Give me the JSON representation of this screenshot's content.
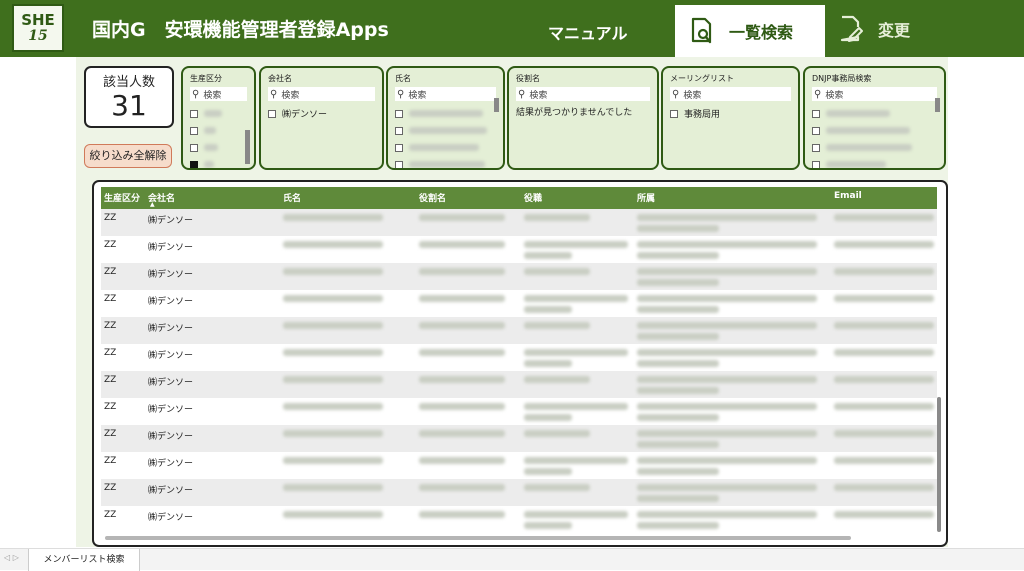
{
  "header": {
    "logo_line1": "SHE",
    "logo_line2": "15",
    "title": "国内G　安環機能管理者登録Apps",
    "nav": {
      "manual": "マニュアル",
      "search": "一覧検索",
      "change": "変更"
    }
  },
  "count": {
    "label": "該当人数",
    "value": "31"
  },
  "clear_filters": "絞り込み全解除",
  "search_placeholder": "検索",
  "slicers": {
    "production": {
      "title": "生産区分"
    },
    "company": {
      "title": "会社名",
      "item": "㈱デンソー"
    },
    "name": {
      "title": "氏名"
    },
    "role": {
      "title": "役割名",
      "no_result": "結果が見つかりませんでした"
    },
    "mailing": {
      "title": "メーリングリスト",
      "item": "事務局用"
    },
    "dnjp": {
      "title": "DNJP事務局検索"
    }
  },
  "table": {
    "columns": [
      "生産区分",
      "会社名",
      "氏名",
      "役割名",
      "役職",
      "所属",
      "Email"
    ],
    "rows": [
      {
        "production": "ZZ",
        "company": "㈱デンソー"
      },
      {
        "production": "ZZ",
        "company": "㈱デンソー"
      },
      {
        "production": "ZZ",
        "company": "㈱デンソー"
      },
      {
        "production": "ZZ",
        "company": "㈱デンソー"
      },
      {
        "production": "ZZ",
        "company": "㈱デンソー"
      },
      {
        "production": "ZZ",
        "company": "㈱デンソー"
      },
      {
        "production": "ZZ",
        "company": "㈱デンソー"
      },
      {
        "production": "ZZ",
        "company": "㈱デンソー"
      },
      {
        "production": "ZZ",
        "company": "㈱デンソー"
      },
      {
        "production": "ZZ",
        "company": "㈱デンソー"
      },
      {
        "production": "ZZ",
        "company": "㈱デンソー"
      },
      {
        "production": "ZZ",
        "company": "㈱デンソー"
      }
    ]
  },
  "page_tab": "メンバーリスト検索"
}
